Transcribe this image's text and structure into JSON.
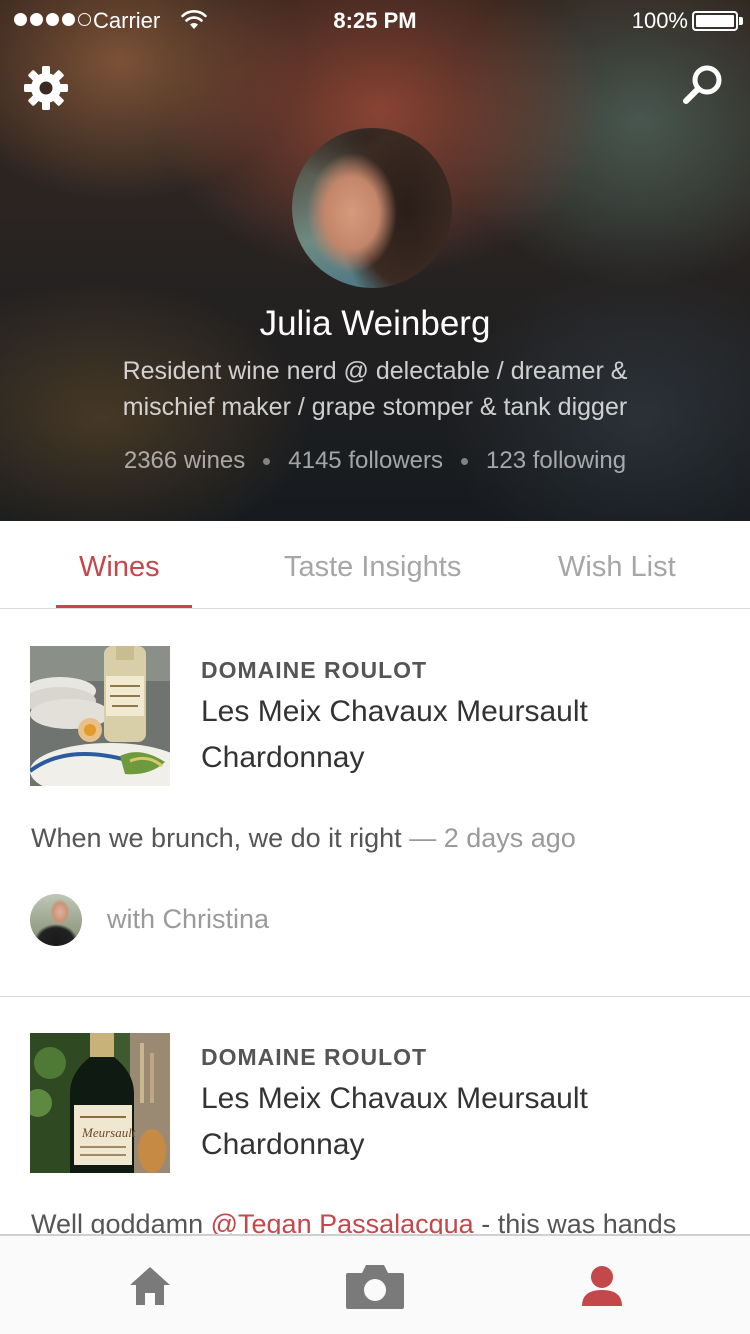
{
  "status_bar": {
    "carrier": "Carrier",
    "time": "8:25 PM",
    "battery": "100%"
  },
  "header": {
    "settings_icon": "gear-icon",
    "search_icon": "search-icon"
  },
  "profile": {
    "name": "Julia Weinberg",
    "bio_line1": "Resident wine nerd @ delectable / dreamer &",
    "bio_line2": "mischief maker / grape stomper & tank digger",
    "stats": {
      "wines": "2366 wines",
      "followers": "4145 followers",
      "following": "123 following"
    }
  },
  "tabs": [
    {
      "label": "Wines",
      "active": true
    },
    {
      "label": "Taste Insights",
      "active": false
    },
    {
      "label": "Wish List",
      "active": false
    }
  ],
  "feed": [
    {
      "producer": "DOMAINE ROULOT",
      "wine_line1": "Les Meix Chavaux Meursault",
      "wine_line2": "Chardonnay",
      "note": "When we brunch, we do it right",
      "note_sep": " — ",
      "ago": "2 days ago",
      "with": "with Christina"
    },
    {
      "producer": "DOMAINE ROULOT",
      "wine_line1": "Les Meix Chavaux Meursault",
      "wine_line2": "Chardonnay",
      "note_prefix": "Well goddamn ",
      "mention": "@Tegan Passalacqua",
      "note_suffix": " - this was hands"
    }
  ],
  "tab_bar": {
    "items": [
      "home-icon",
      "camera-icon",
      "profile-icon"
    ],
    "active_color": "#c4474b",
    "inactive_color": "#7a7a7a"
  },
  "colors": {
    "accent": "#c4474b"
  }
}
